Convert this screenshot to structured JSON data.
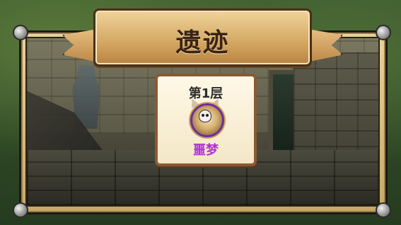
{
  "banner": {
    "title": "遗迹"
  },
  "floor_card": {
    "floor_label": "第1层",
    "difficulty_label": "噩梦",
    "difficulty_icon": "skull-emblem-icon"
  },
  "colors": {
    "banner_text": "#3A2312",
    "difficulty_text": "#B033D6",
    "card_border": "#8A5A32"
  }
}
